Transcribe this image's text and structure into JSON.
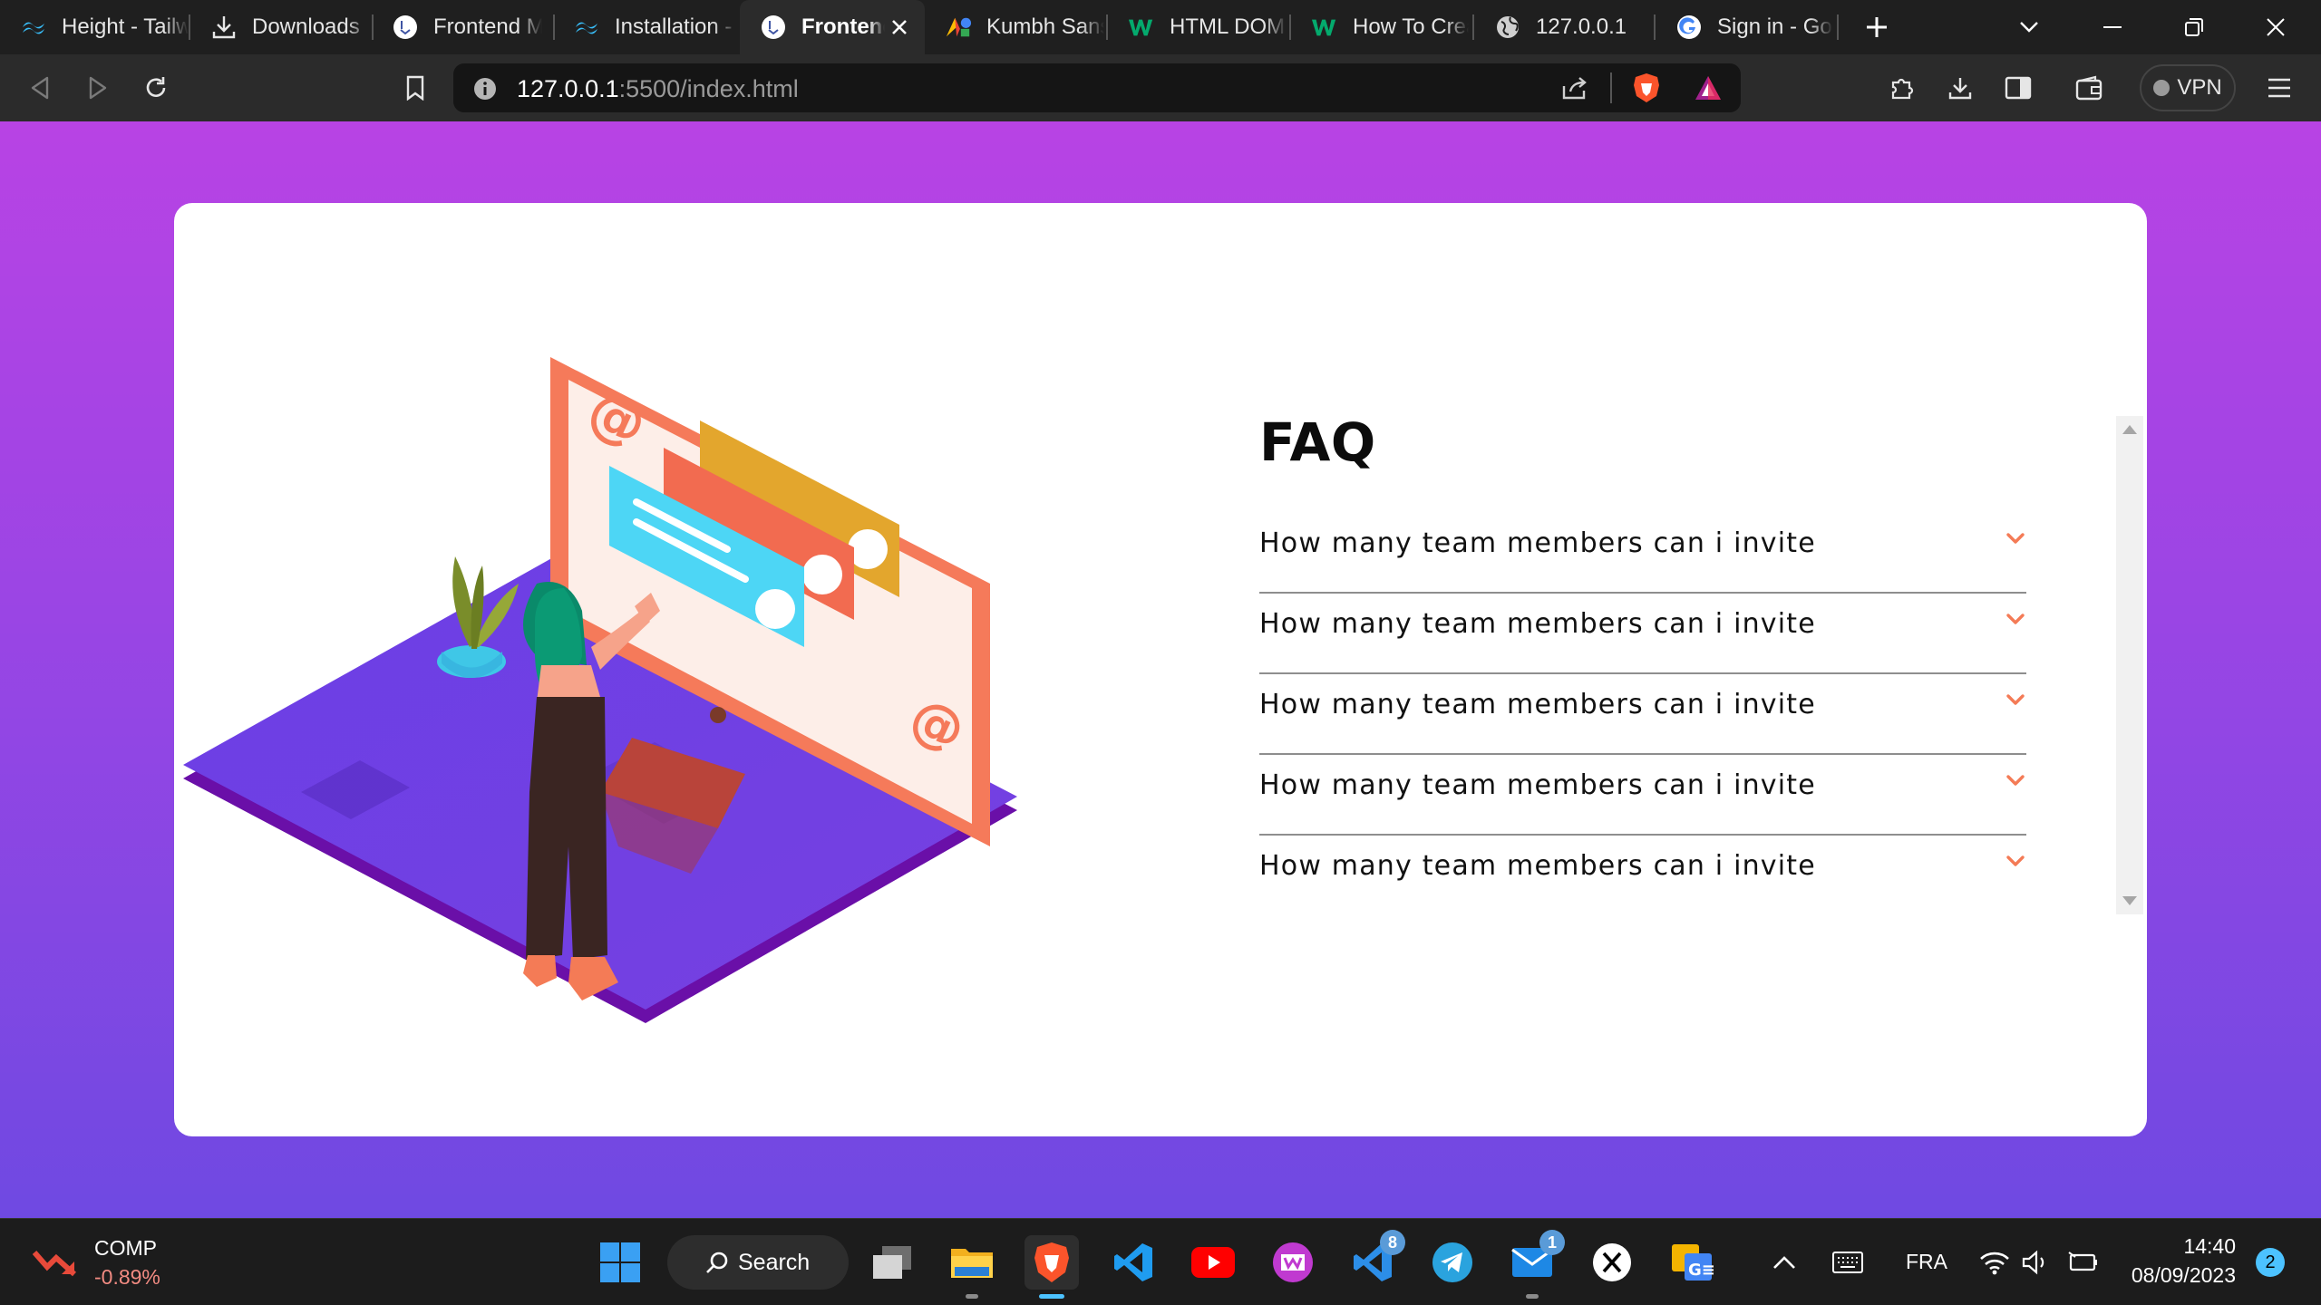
{
  "browser": {
    "tabs": [
      {
        "label": "Height - Tailwind CSS",
        "icon": "tailwind-icon",
        "active": false
      },
      {
        "label": "Downloads",
        "icon": "download-icon",
        "active": false
      },
      {
        "label": "Frontend Mentor",
        "icon": "frontend-mentor-icon",
        "active": false
      },
      {
        "label": "Installation - Tailwind CSS",
        "icon": "tailwind-icon",
        "active": false
      },
      {
        "label": "Frontend Mentor",
        "icon": "frontend-mentor-icon",
        "active": true
      },
      {
        "label": "Kumbh Sans - Google Fonts",
        "icon": "google-fonts-icon",
        "active": false
      },
      {
        "label": "HTML DOM",
        "icon": "w3schools-icon",
        "active": false
      },
      {
        "label": "How To Create",
        "icon": "w3schools-icon",
        "active": false
      },
      {
        "label": "127.0.0.1",
        "icon": "globe-icon",
        "active": false
      },
      {
        "label": "Sign in - Google",
        "icon": "google-icon",
        "active": false
      }
    ],
    "url_host": "127.0.0.1",
    "url_path": ":5500/index.html",
    "vpn_label": "VPN"
  },
  "page": {
    "faq_title": "FAQ",
    "faq_items": [
      {
        "question": "How many team members can i invite"
      },
      {
        "question": "How many team members can i invite"
      },
      {
        "question": "How many team members can i invite"
      },
      {
        "question": "How many team members can i invite"
      },
      {
        "question": "How many team members can i invite"
      }
    ],
    "accent_color": "#f47b56"
  },
  "taskbar": {
    "stock_name": "COMP",
    "stock_change": "-0.89%",
    "search_label": "Search",
    "apps": [
      {
        "name": "windows-start-icon"
      },
      {
        "name": "task-view-icon"
      },
      {
        "name": "file-explorer-icon"
      },
      {
        "name": "brave-browser-icon"
      },
      {
        "name": "vscode-icon"
      },
      {
        "name": "youtube-icon"
      },
      {
        "name": "office-icon"
      },
      {
        "name": "vscode-insiders-icon",
        "badge": "8"
      },
      {
        "name": "telegram-icon"
      },
      {
        "name": "mail-icon",
        "badge": "1"
      },
      {
        "name": "x-icon"
      },
      {
        "name": "translate-icon"
      }
    ],
    "language": "FRA",
    "time": "14:40",
    "date": "08/09/2023",
    "notifications": "2"
  }
}
